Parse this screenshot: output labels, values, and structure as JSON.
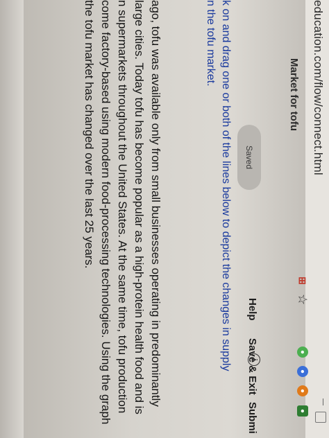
{
  "browser": {
    "address": "education.com/flow/connect.html"
  },
  "header": {
    "saved_label": "Saved",
    "help_label": "Help",
    "save_exit_label": "Save & Exit",
    "submit_label": "Submi"
  },
  "question": {
    "paragraph_lines": [
      "ago, tofu was available only from small businesses operating in predominantly",
      "large cities. Today tofu has become popular as a high-protein health food and is",
      "n supermarkets throughout the United States. At the same time, tofu production",
      "come factory-based using modern food-processing technologies. Using the graph",
      "the tofu market has changed over the last 25 years."
    ],
    "instruction_lines": [
      "k on and drag one or both of the lines below to depict the changes in supply",
      "n the tofu market."
    ],
    "graph_title": "Market for tofu",
    "info_symbol": "i"
  },
  "colors": {
    "link_blue": "#1a3a9e",
    "saved_pill": "#b9b6b1"
  }
}
